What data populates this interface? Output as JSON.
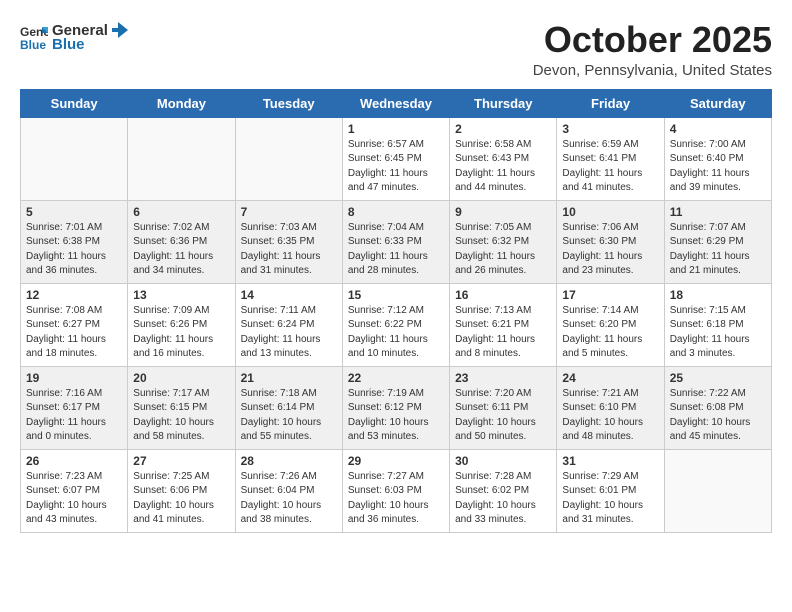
{
  "header": {
    "logo_general": "General",
    "logo_blue": "Blue",
    "month_title": "October 2025",
    "location": "Devon, Pennsylvania, United States"
  },
  "weekdays": [
    "Sunday",
    "Monday",
    "Tuesday",
    "Wednesday",
    "Thursday",
    "Friday",
    "Saturday"
  ],
  "weeks": [
    [
      {
        "day": "",
        "info": "",
        "empty": true
      },
      {
        "day": "",
        "info": "",
        "empty": true
      },
      {
        "day": "",
        "info": "",
        "empty": true
      },
      {
        "day": "1",
        "info": "Sunrise: 6:57 AM\nSunset: 6:45 PM\nDaylight: 11 hours\nand 47 minutes."
      },
      {
        "day": "2",
        "info": "Sunrise: 6:58 AM\nSunset: 6:43 PM\nDaylight: 11 hours\nand 44 minutes."
      },
      {
        "day": "3",
        "info": "Sunrise: 6:59 AM\nSunset: 6:41 PM\nDaylight: 11 hours\nand 41 minutes."
      },
      {
        "day": "4",
        "info": "Sunrise: 7:00 AM\nSunset: 6:40 PM\nDaylight: 11 hours\nand 39 minutes."
      }
    ],
    [
      {
        "day": "5",
        "info": "Sunrise: 7:01 AM\nSunset: 6:38 PM\nDaylight: 11 hours\nand 36 minutes."
      },
      {
        "day": "6",
        "info": "Sunrise: 7:02 AM\nSunset: 6:36 PM\nDaylight: 11 hours\nand 34 minutes."
      },
      {
        "day": "7",
        "info": "Sunrise: 7:03 AM\nSunset: 6:35 PM\nDaylight: 11 hours\nand 31 minutes."
      },
      {
        "day": "8",
        "info": "Sunrise: 7:04 AM\nSunset: 6:33 PM\nDaylight: 11 hours\nand 28 minutes."
      },
      {
        "day": "9",
        "info": "Sunrise: 7:05 AM\nSunset: 6:32 PM\nDaylight: 11 hours\nand 26 minutes."
      },
      {
        "day": "10",
        "info": "Sunrise: 7:06 AM\nSunset: 6:30 PM\nDaylight: 11 hours\nand 23 minutes."
      },
      {
        "day": "11",
        "info": "Sunrise: 7:07 AM\nSunset: 6:29 PM\nDaylight: 11 hours\nand 21 minutes."
      }
    ],
    [
      {
        "day": "12",
        "info": "Sunrise: 7:08 AM\nSunset: 6:27 PM\nDaylight: 11 hours\nand 18 minutes."
      },
      {
        "day": "13",
        "info": "Sunrise: 7:09 AM\nSunset: 6:26 PM\nDaylight: 11 hours\nand 16 minutes."
      },
      {
        "day": "14",
        "info": "Sunrise: 7:11 AM\nSunset: 6:24 PM\nDaylight: 11 hours\nand 13 minutes."
      },
      {
        "day": "15",
        "info": "Sunrise: 7:12 AM\nSunset: 6:22 PM\nDaylight: 11 hours\nand 10 minutes."
      },
      {
        "day": "16",
        "info": "Sunrise: 7:13 AM\nSunset: 6:21 PM\nDaylight: 11 hours\nand 8 minutes."
      },
      {
        "day": "17",
        "info": "Sunrise: 7:14 AM\nSunset: 6:20 PM\nDaylight: 11 hours\nand 5 minutes."
      },
      {
        "day": "18",
        "info": "Sunrise: 7:15 AM\nSunset: 6:18 PM\nDaylight: 11 hours\nand 3 minutes."
      }
    ],
    [
      {
        "day": "19",
        "info": "Sunrise: 7:16 AM\nSunset: 6:17 PM\nDaylight: 11 hours\nand 0 minutes."
      },
      {
        "day": "20",
        "info": "Sunrise: 7:17 AM\nSunset: 6:15 PM\nDaylight: 10 hours\nand 58 minutes."
      },
      {
        "day": "21",
        "info": "Sunrise: 7:18 AM\nSunset: 6:14 PM\nDaylight: 10 hours\nand 55 minutes."
      },
      {
        "day": "22",
        "info": "Sunrise: 7:19 AM\nSunset: 6:12 PM\nDaylight: 10 hours\nand 53 minutes."
      },
      {
        "day": "23",
        "info": "Sunrise: 7:20 AM\nSunset: 6:11 PM\nDaylight: 10 hours\nand 50 minutes."
      },
      {
        "day": "24",
        "info": "Sunrise: 7:21 AM\nSunset: 6:10 PM\nDaylight: 10 hours\nand 48 minutes."
      },
      {
        "day": "25",
        "info": "Sunrise: 7:22 AM\nSunset: 6:08 PM\nDaylight: 10 hours\nand 45 minutes."
      }
    ],
    [
      {
        "day": "26",
        "info": "Sunrise: 7:23 AM\nSunset: 6:07 PM\nDaylight: 10 hours\nand 43 minutes."
      },
      {
        "day": "27",
        "info": "Sunrise: 7:25 AM\nSunset: 6:06 PM\nDaylight: 10 hours\nand 41 minutes."
      },
      {
        "day": "28",
        "info": "Sunrise: 7:26 AM\nSunset: 6:04 PM\nDaylight: 10 hours\nand 38 minutes."
      },
      {
        "day": "29",
        "info": "Sunrise: 7:27 AM\nSunset: 6:03 PM\nDaylight: 10 hours\nand 36 minutes."
      },
      {
        "day": "30",
        "info": "Sunrise: 7:28 AM\nSunset: 6:02 PM\nDaylight: 10 hours\nand 33 minutes."
      },
      {
        "day": "31",
        "info": "Sunrise: 7:29 AM\nSunset: 6:01 PM\nDaylight: 10 hours\nand 31 minutes."
      },
      {
        "day": "",
        "info": "",
        "empty": true
      }
    ]
  ]
}
